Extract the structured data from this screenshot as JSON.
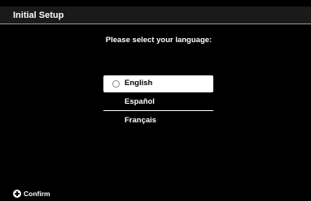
{
  "header": {
    "title": "Initial Setup"
  },
  "main": {
    "prompt": "Please select your language:",
    "languages": [
      {
        "label": "English",
        "selected": true
      },
      {
        "label": "Español",
        "selected": false
      },
      {
        "label": "Français",
        "selected": false
      }
    ]
  },
  "footer": {
    "confirm_icon": "plus-circle-icon",
    "confirm_label": "Confirm"
  },
  "colors": {
    "background": "#000000",
    "title_bar": "#1a1a1a",
    "highlight": "#ffffff",
    "text": "#ffffff"
  }
}
